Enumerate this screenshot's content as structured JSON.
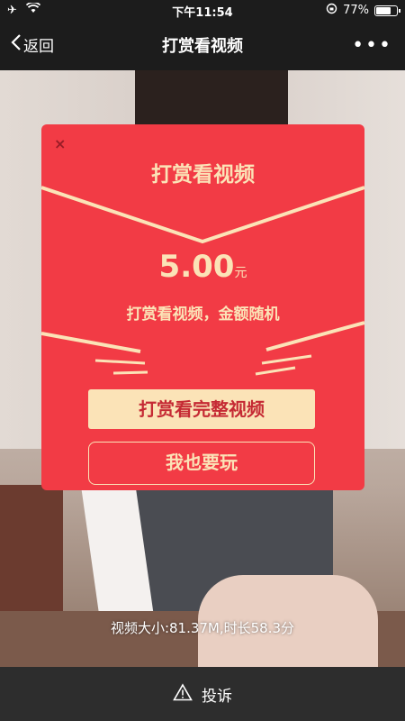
{
  "status_bar": {
    "time": "下午11:54",
    "battery_text": "77%",
    "battery_level": 0.77
  },
  "nav": {
    "back_label": "返回",
    "title": "打赏看视频",
    "more_label": "•••"
  },
  "modal": {
    "close_label": "×",
    "title": "打赏看视频",
    "amount": "5.00",
    "amount_unit": "元",
    "description": "打赏看视频，金额随机",
    "watch_button": "打赏看完整视频",
    "play_button": "我也要玩"
  },
  "video_info": "视频大小:81.37M,时长58.3分",
  "bottom_bar": {
    "report_label": "投诉",
    "report_icon": "warning-icon"
  },
  "colors": {
    "modal_red": "#f23b45",
    "cream": "#fbe3b7",
    "dark_bar": "#1c1c1c"
  }
}
